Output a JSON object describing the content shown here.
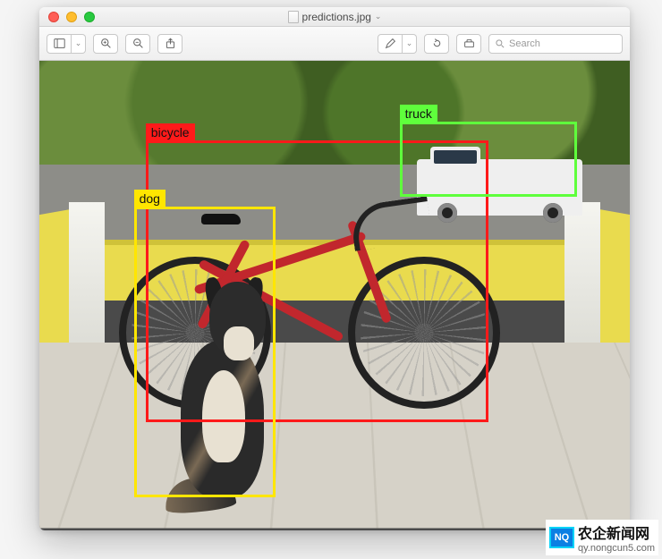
{
  "window": {
    "filename": "predictions.jpg"
  },
  "toolbar": {
    "search_placeholder": "Search"
  },
  "detections": {
    "bicycle": {
      "label": "bicycle"
    },
    "dog": {
      "label": "dog"
    },
    "truck": {
      "label": "truck"
    }
  },
  "watermark": {
    "logo_text": "NQ",
    "cn_text": "农企新闻网",
    "url": "qy.nongcun5.com"
  }
}
